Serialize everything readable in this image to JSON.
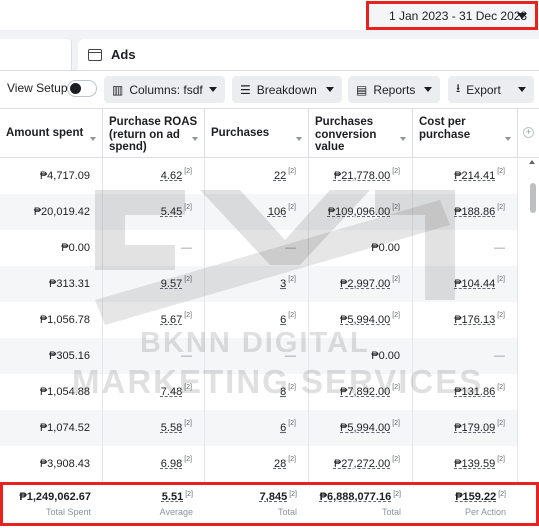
{
  "date_range": {
    "label": "1 Jan 2023 - 31 Dec 2023"
  },
  "tabs": {
    "ads_label": "Ads"
  },
  "toolbar": {
    "view_setup": "View Setup",
    "columns": "Columns: fsdf",
    "breakdown": "Breakdown",
    "reports": "Reports",
    "export": "Export"
  },
  "table": {
    "headers": [
      "Amount spent",
      "Purchase ROAS (return on ad spend)",
      "Purchases",
      "Purchases conversion value",
      "Cost per purchase"
    ],
    "footnote_marker": "[2]",
    "rows": [
      [
        "₱4,717.09",
        "4.62",
        "22",
        "₱21,778.00",
        "₱214.41"
      ],
      [
        "₱20,019.42",
        "5.45",
        "106",
        "₱109,096.00",
        "₱188.86"
      ],
      [
        "₱0.00",
        "—",
        "—",
        "₱0.00",
        "—"
      ],
      [
        "₱313.31",
        "9.57",
        "3",
        "₱2,997.00",
        "₱104.44"
      ],
      [
        "₱1,056.78",
        "5.67",
        "6",
        "₱5,994.00",
        "₱176.13"
      ],
      [
        "₱305.16",
        "—",
        "—",
        "₱0.00",
        "—"
      ],
      [
        "₱1,054.88",
        "7.48",
        "8",
        "₱7,892.00",
        "₱131.86"
      ],
      [
        "₱1,074.52",
        "5.58",
        "6",
        "₱5,994.00",
        "₱179.09"
      ],
      [
        "₱3,908.43",
        "6.98",
        "28",
        "₱27,272.00",
        "₱139.59"
      ]
    ],
    "totals": {
      "values": [
        "₱1,249,062.67",
        "5.51",
        "7,845",
        "₱6,888,077.16",
        "₱159.22"
      ],
      "labels": [
        "Total Spent",
        "Average",
        "Total",
        "Total",
        "Per Action"
      ]
    }
  },
  "watermark": {
    "line1": "BKNN DIGITAL",
    "line2": "MARKETING SERVICES"
  },
  "colors": {
    "highlight_border": "#e8231f",
    "button_bg": "#ebedf0",
    "header_border": "#dadde1"
  },
  "icons": [
    "chevron-down-icon",
    "ads-panel-icon",
    "columns-icon",
    "breakdown-icon",
    "reports-icon",
    "export-icon",
    "add-column-icon",
    "sort-icon"
  ]
}
